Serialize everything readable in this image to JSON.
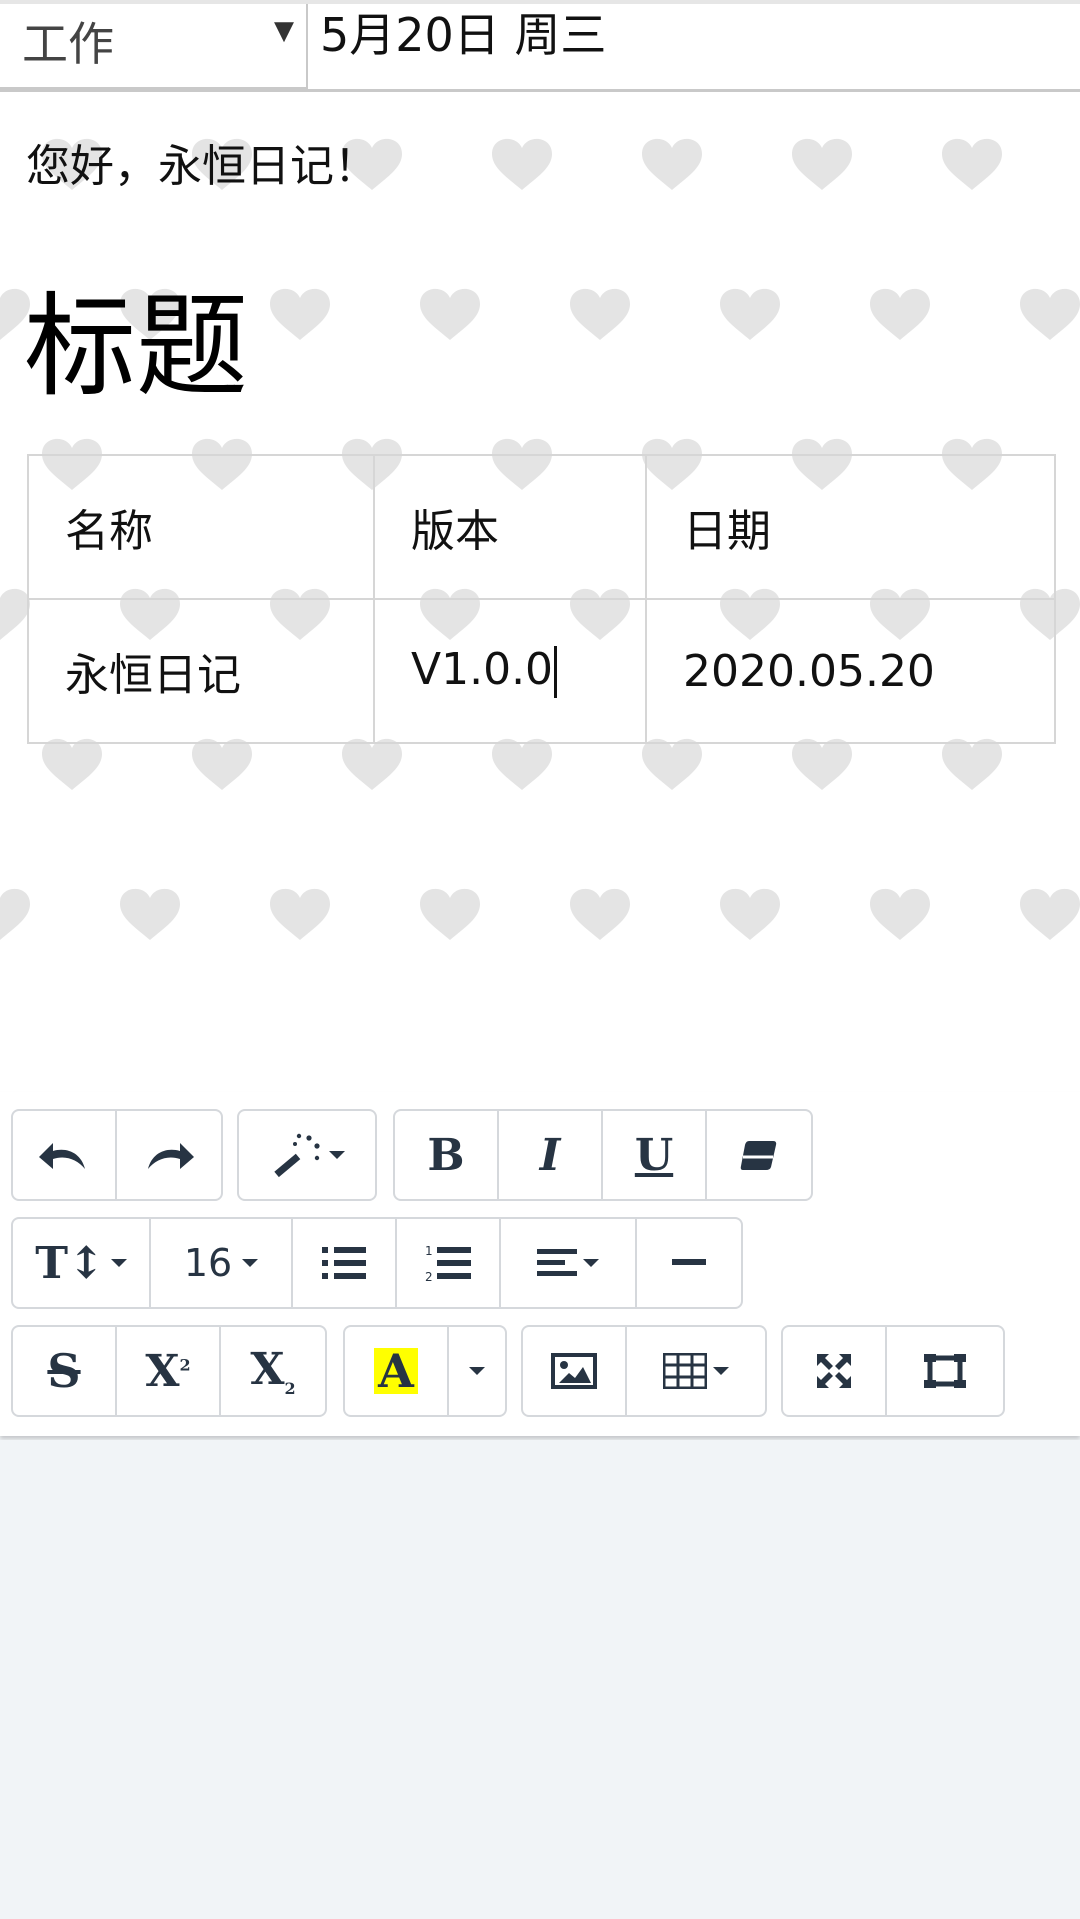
{
  "header": {
    "category": "工作",
    "category_arrow": "▼",
    "date": "5月20日 周三"
  },
  "editor": {
    "greeting": "您好，永恒日记！",
    "title": "标题",
    "table": {
      "rows": [
        [
          "名称",
          "版本",
          "日期"
        ],
        [
          "永恒日记",
          "V1.0.0",
          "2020.05.20"
        ]
      ]
    }
  },
  "toolbar": {
    "font_size": "16",
    "icons": {
      "undo": "undo-icon",
      "redo": "redo-icon",
      "style": "magic-wand-icon",
      "bold": "bold-icon",
      "italic": "italic-icon",
      "underline": "underline-icon",
      "eraser": "eraser-icon",
      "text_height": "text-height-icon",
      "font_size": "font-size-dropdown",
      "unordered_list": "unordered-list-icon",
      "ordered_list": "ordered-list-icon",
      "align": "align-icon",
      "horizontal_rule": "horizontal-rule-icon",
      "strikethrough": "strikethrough-icon",
      "superscript": "superscript-icon",
      "subscript": "subscript-icon",
      "font_color": "font-color-icon",
      "color_dropdown": "chevron-down-icon",
      "picture": "picture-icon",
      "table": "table-icon",
      "fullscreen": "fullscreen-icon",
      "code_view": "code-view-icon"
    },
    "highlight_color": "#ffff00",
    "icon_color": "#273443"
  }
}
